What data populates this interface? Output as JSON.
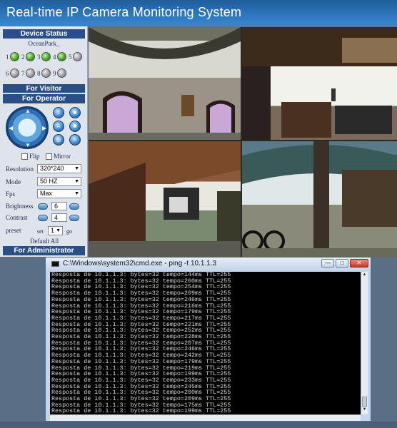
{
  "header": {
    "title": "Real-time IP Camera Monitoring System"
  },
  "sidebar": {
    "device_status": "Device Status",
    "device_name": "OceanPark_",
    "devices": [
      {
        "n": "1",
        "on": true
      },
      {
        "n": "2",
        "on": true
      },
      {
        "n": "3",
        "on": true
      },
      {
        "n": "4",
        "on": true
      },
      {
        "n": "5",
        "on": false
      },
      {
        "n": "6",
        "on": false
      },
      {
        "n": "7",
        "on": false
      },
      {
        "n": "8",
        "on": false
      },
      {
        "n": "9",
        "on": false
      }
    ],
    "for_visitor": "For Visitor",
    "for_operator": "For Operator",
    "flip_label": "Flip",
    "mirror_label": "Mirror",
    "resolution_label": "Resolution",
    "resolution_value": "320*240",
    "mode_label": "Mode",
    "mode_value": "50 HZ",
    "fps_label": "Fps",
    "fps_value": "Max",
    "brightness_label": "Brightness",
    "brightness_value": "6",
    "contrast_label": "Contrast",
    "contrast_value": "4",
    "preset_label": "preset",
    "preset_set": "set",
    "preset_value": "1",
    "preset_go": "go",
    "default_all": "Default All",
    "for_administrator": "For Administrator"
  },
  "cmd": {
    "title": "C:\\Windows\\system32\\cmd.exe - ping  -t 10.1.1.3",
    "lines": [
      "Resposta de 10.1.1.3: bytes=32 tempo=144ms TTL=255",
      "Resposta de 10.1.1.3: bytes=32 tempo=260ms TTL=255",
      "Resposta de 10.1.1.3: bytes=32 tempo=254ms TTL=255",
      "Resposta de 10.1.1.3: bytes=32 tempo=209ms TTL=255",
      "Resposta de 10.1.1.3: bytes=32 tempo=246ms TTL=255",
      "Resposta de 10.1.1.3: bytes=32 tempo=216ms TTL=255",
      "Resposta de 10.1.1.3: bytes=32 tempo=179ms TTL=255",
      "Resposta de 10.1.1.3: bytes=32 tempo=217ms TTL=255",
      "Resposta de 10.1.1.3: bytes=32 tempo=221ms TTL=255",
      "Resposta de 10.1.1.3: bytes=32 tempo=252ms TTL=255",
      "Resposta de 10.1.1.3: bytes=32 tempo=228ms TTL=255",
      "Resposta de 10.1.1.3: bytes=32 tempo=207ms TTL=255",
      "Resposta de 10.1.1.3: bytes=32 tempo=246ms TTL=255",
      "Resposta de 10.1.1.3: bytes=32 tempo=242ms TTL=255",
      "Resposta de 10.1.1.3: bytes=32 tempo=179ms TTL=255",
      "Resposta de 10.1.1.3: bytes=32 tempo=219ms TTL=255",
      "Resposta de 10.1.1.3: bytes=32 tempo=199ms TTL=255",
      "Resposta de 10.1.1.3: bytes=32 tempo=233ms TTL=255",
      "Resposta de 10.1.1.3: bytes=32 tempo=245ms TTL=255",
      "Resposta de 10.1.1.3: bytes=32 tempo=200ms TTL=255",
      "Resposta de 10.1.1.3: bytes=32 tempo=209ms TTL=255",
      "Resposta de 10.1.1.3: bytes=32 tempo=175ms TTL=255",
      "Resposta de 10.1.1.3: bytes=32 tempo=199ms TTL=255",
      "Resposta de 10.1.1.3: bytes=32 tempo=200ms TTL=255",
      "_"
    ],
    "minimize": "—",
    "maximize": "□",
    "close": "✕"
  },
  "icons": {
    "ptz": "ptz-joystick-icon",
    "camera_control": "camera-control-icon"
  }
}
